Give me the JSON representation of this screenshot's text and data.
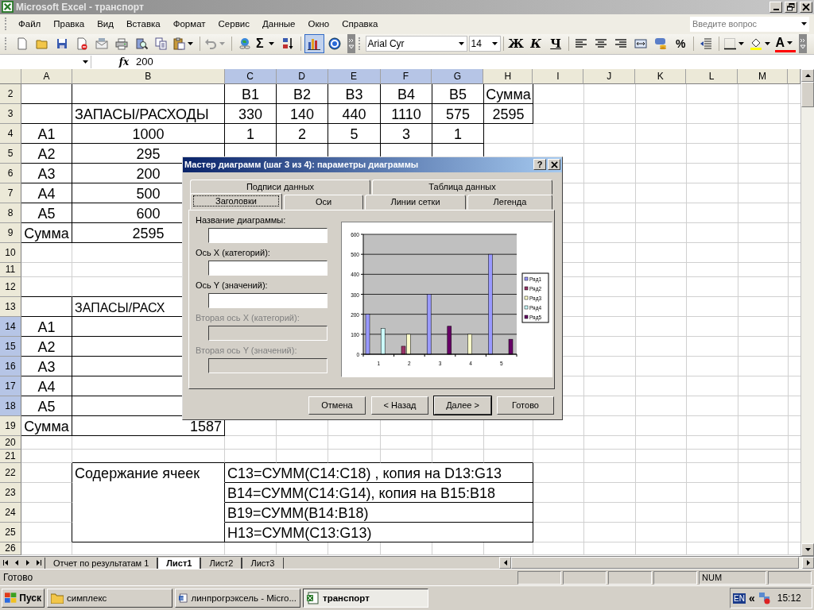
{
  "window": {
    "title": "Microsoft Excel - транспорт"
  },
  "menu": [
    "Файл",
    "Правка",
    "Вид",
    "Вставка",
    "Формат",
    "Сервис",
    "Данные",
    "Окно",
    "Справка"
  ],
  "help_search": {
    "placeholder": "Введите вопрос"
  },
  "toolbar": {
    "font": "Arial Cyr",
    "size": "14",
    "sum": "Σ",
    "bold": "Ж",
    "italic": "К",
    "underline": "Ч",
    "percent": "%",
    "font_color": "A",
    "chart_wizard_pressed": true
  },
  "formula_bar": {
    "fx": "fx",
    "value": "200"
  },
  "sheet": {
    "columns": [
      {
        "label": "A",
        "selected": false
      },
      {
        "label": "B",
        "selected": false
      },
      {
        "label": "C",
        "selected": true
      },
      {
        "label": "D",
        "selected": true
      },
      {
        "label": "E",
        "selected": true
      },
      {
        "label": "F",
        "selected": true
      },
      {
        "label": "G",
        "selected": true
      },
      {
        "label": "H",
        "selected": false
      },
      {
        "label": "I",
        "selected": false
      },
      {
        "label": "J",
        "selected": false
      },
      {
        "label": "K",
        "selected": false
      },
      {
        "label": "L",
        "selected": false
      },
      {
        "label": "M",
        "selected": false
      }
    ],
    "rows": [
      {
        "number": "2",
        "selected": false,
        "c": "B1",
        "d": "B2",
        "e": "B3",
        "f": "B4",
        "g": "B5",
        "h": "Сумма"
      },
      {
        "number": "3",
        "selected": false,
        "b": "ЗАПАСЫ/РАСХОДЫ",
        "c": "330",
        "d": "140",
        "e": "440",
        "f": "1110",
        "g": "575",
        "h": "2595"
      },
      {
        "number": "4",
        "selected": false,
        "a": "A1",
        "b": "1000",
        "c": "1",
        "d": "2",
        "e": "5",
        "f": "3",
        "g": "1"
      },
      {
        "number": "5",
        "selected": false,
        "a": "A2",
        "b": "295"
      },
      {
        "number": "6",
        "selected": false,
        "a": "A3",
        "b": "200"
      },
      {
        "number": "7",
        "selected": false,
        "a": "A4",
        "b": "500"
      },
      {
        "number": "8",
        "selected": false,
        "a": "A5",
        "b": "600"
      },
      {
        "number": "9",
        "selected": false,
        "a": "Сумма",
        "b": "2595"
      },
      {
        "number": "10",
        "selected": false
      },
      {
        "number": "11",
        "selected": false
      },
      {
        "number": "12",
        "selected": false
      },
      {
        "number": "13",
        "selected": false,
        "b": "ЗАПАСЫ/РАСХ"
      },
      {
        "number": "14",
        "selected": true,
        "a": "A1"
      },
      {
        "number": "15",
        "selected": true,
        "a": "A2"
      },
      {
        "number": "16",
        "selected": true,
        "a": "A3"
      },
      {
        "number": "17",
        "selected": true,
        "a": "A4"
      },
      {
        "number": "18",
        "selected": true,
        "a": "A5"
      },
      {
        "number": "19",
        "selected": false,
        "a": "Сумма",
        "b": "1587"
      },
      {
        "number": "20",
        "selected": false
      },
      {
        "number": "21",
        "selected": false
      },
      {
        "number": "22",
        "selected": false,
        "b": "Содержание ячеек",
        "c": "C13=СУММ(C14:C18) , копия на D13:G13"
      },
      {
        "number": "23",
        "selected": false,
        "c": "B14=СУММ(C14:G14), копия на B15:B18"
      },
      {
        "number": "24",
        "selected": false,
        "c": "B19=СУММ(B14:B18)"
      },
      {
        "number": "25",
        "selected": false,
        "c": "H13=СУММ(C13:G13)"
      },
      {
        "number": "26",
        "selected": false
      }
    ]
  },
  "dialog": {
    "title": "Мастер диаграмм (шаг 3 из 4): параметры диаграммы",
    "help": "?",
    "tabs_back": [
      {
        "label": "Подписи данных",
        "selected": false
      },
      {
        "label": "Таблица данных",
        "selected": false
      }
    ],
    "tabs_front": [
      {
        "label": "Заголовки",
        "selected": true
      },
      {
        "label": "Оси",
        "selected": false
      },
      {
        "label": "Линии сетки",
        "selected": false
      },
      {
        "label": "Легенда",
        "selected": false
      }
    ],
    "fields": [
      {
        "label": "Название диаграммы:",
        "disabled": false
      },
      {
        "label": "Ось X (категорий):",
        "disabled": false
      },
      {
        "label": "Ось Y (значений):",
        "disabled": false
      },
      {
        "label": "Вторая ось X (категорий):",
        "disabled": true
      },
      {
        "label": "Вторая ось Y (значений):",
        "disabled": true
      }
    ],
    "chart_data": {
      "type": "bar",
      "grid": true,
      "legend": true,
      "categories": [
        "1",
        "2",
        "3",
        "4",
        "5"
      ],
      "yticks": [
        {
          "value": 0,
          "label": "0"
        },
        {
          "value": 100,
          "label": "100"
        },
        {
          "value": 200,
          "label": "200"
        },
        {
          "value": 300,
          "label": "300"
        },
        {
          "value": 400,
          "label": "400"
        },
        {
          "value": 500,
          "label": "500"
        },
        {
          "value": 600,
          "label": "600"
        }
      ],
      "ylim": [
        0,
        600
      ],
      "series": [
        {
          "name": "Ряд1",
          "color": "#9999ff",
          "values": [
            200,
            0,
            300,
            0,
            500
          ]
        },
        {
          "name": "Ряд2",
          "color": "#993366",
          "values": [
            0,
            40,
            0,
            0,
            0
          ]
        },
        {
          "name": "Ряд3",
          "color": "#ffffcc",
          "values": [
            0,
            100,
            0,
            100,
            0
          ]
        },
        {
          "name": "Ряд4",
          "color": "#ccffff",
          "values": [
            130,
            0,
            0,
            0,
            0
          ]
        },
        {
          "name": "Ряд5",
          "color": "#660066",
          "values": [
            0,
            0,
            140,
            0,
            75
          ]
        }
      ]
    },
    "buttons": [
      {
        "label": "Отмена",
        "default": false
      },
      {
        "label": "< Назад",
        "default": false
      },
      {
        "label": "Далее >",
        "default": true
      },
      {
        "label": "Готово",
        "default": false
      }
    ]
  },
  "sheet_tabs": [
    {
      "label": "Отчет по результатам 1",
      "selected": false
    },
    {
      "label": "Лист1",
      "selected": true
    },
    {
      "label": "Лист2",
      "selected": false
    },
    {
      "label": "Лист3",
      "selected": false
    }
  ],
  "status_bar": {
    "text": "Готово",
    "indicator": "NUM"
  },
  "taskbar": {
    "start": "Пуск",
    "items": [
      {
        "label": "симплекс",
        "kind": "folder",
        "selected": false
      },
      {
        "label": "линпрогрэксель - Micro...",
        "kind": "document",
        "selected": false
      },
      {
        "label": "транспорт",
        "kind": "spreadsheet",
        "selected": true
      }
    ],
    "language": "EN",
    "chevron": "«",
    "clock": "15:12"
  }
}
